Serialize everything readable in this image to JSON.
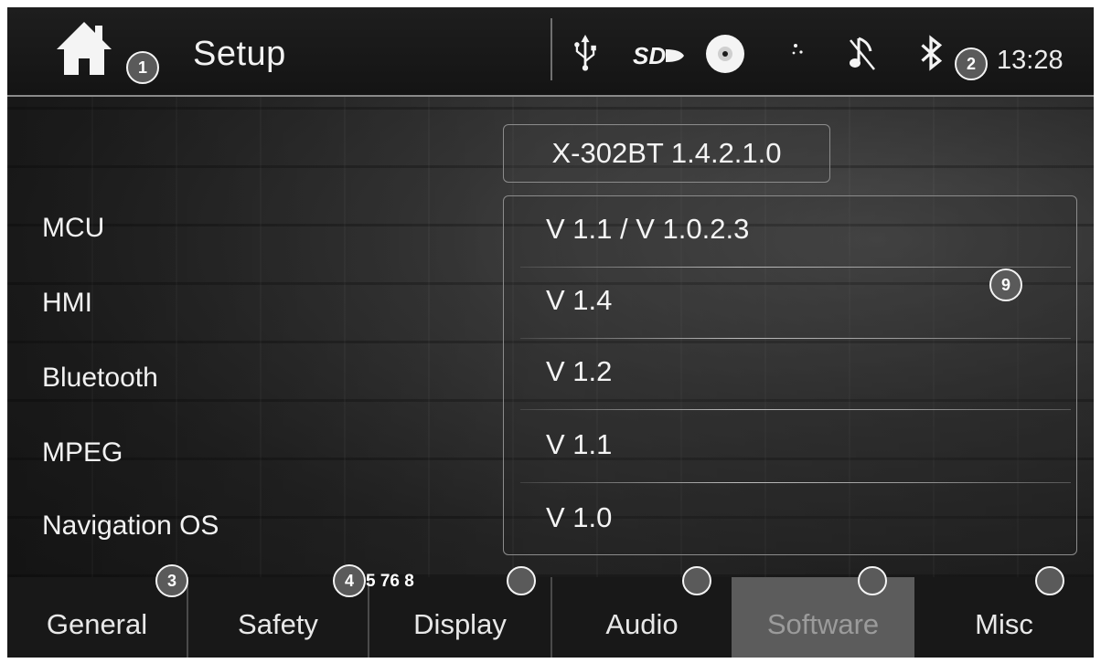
{
  "header": {
    "title": "Setup",
    "time": "13:28",
    "status_icons": [
      "usb-icon",
      "sd-card-icon",
      "disc-icon",
      "night-mode-icon",
      "mute-icon",
      "bluetooth-icon"
    ]
  },
  "firmware": "X-302BT 1.4.2.1.0",
  "versions": [
    {
      "label": "MCU",
      "value": "V 1.1 / V 1.0.2.3"
    },
    {
      "label": "HMI",
      "value": "V 1.4"
    },
    {
      "label": "Bluetooth",
      "value": "V 1.2"
    },
    {
      "label": "MPEG",
      "value": "V 1.1"
    },
    {
      "label": "Navigation OS",
      "value": "V 1.0"
    }
  ],
  "tabs": [
    {
      "label": "General",
      "active": false
    },
    {
      "label": "Safety",
      "active": false
    },
    {
      "label": "Display",
      "active": false
    },
    {
      "label": "Audio",
      "active": false
    },
    {
      "label": "Software",
      "active": true
    },
    {
      "label": "Misc",
      "active": false
    }
  ],
  "callouts": {
    "c1": "1",
    "c2": "2",
    "c3": "3",
    "c4": "4",
    "c5678": "5 76 8",
    "c9": "9"
  },
  "colors": {
    "background": "#1c1c1c",
    "text": "#f2f2f2",
    "active_tab": "#5c5c5c",
    "active_tab_text": "#9b9b9b"
  }
}
